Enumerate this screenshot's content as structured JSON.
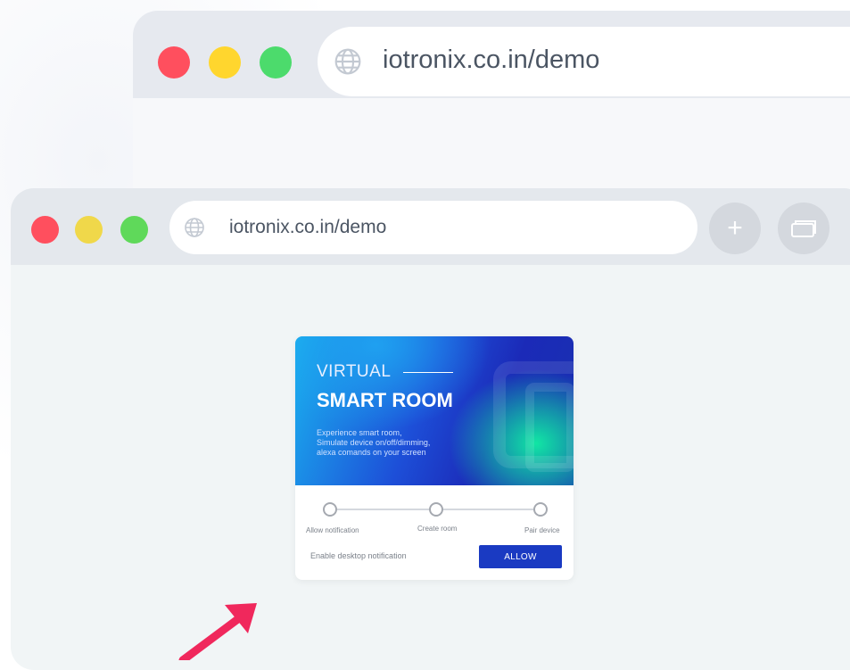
{
  "back_window": {
    "url": "iotronix.co.in/demo",
    "traffic_lights": [
      "#ff4f5e",
      "#ffd62e",
      "#4cdb6c"
    ]
  },
  "front_window": {
    "url": "iotronix.co.in/demo",
    "traffic_lights": [
      "#ff4f5e",
      "#f0d84a",
      "#5fd95a"
    ],
    "buttons": {
      "new_tab_icon": "plus-icon",
      "tabs_icon": "windows-icon"
    }
  },
  "demo_card": {
    "hero": {
      "title_line1": "VIRTUAL",
      "title_line2": "SMART ROOM",
      "description": [
        "Experience smart room,",
        "Simulate device on/off/dimming,",
        "alexa comands on your screen"
      ]
    },
    "steps": [
      {
        "label": "Allow notification"
      },
      {
        "label": "Create room"
      },
      {
        "label": "Pair device"
      }
    ],
    "footer": {
      "text": "Enable desktop notification",
      "button_label": "ALLOW"
    }
  },
  "colors": {
    "accent": "#1a3ac2",
    "arrow": "#f0285c"
  }
}
